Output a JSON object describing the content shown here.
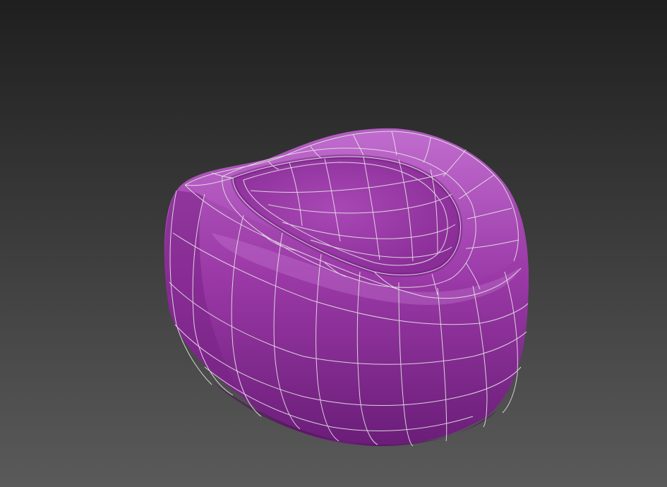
{
  "scene": {
    "subject": "beanbag-chair-mesh",
    "wireframe": true
  },
  "colors": {
    "background_top": "#1f1f1f",
    "background_bottom": "#5a5a5a",
    "mesh_base": "#8b2a96",
    "mesh_light": "#b35ec0",
    "mesh_dark": "#5e1869",
    "mesh_mid": "#9c3aa8",
    "wireframe": "#e6e6e6"
  }
}
